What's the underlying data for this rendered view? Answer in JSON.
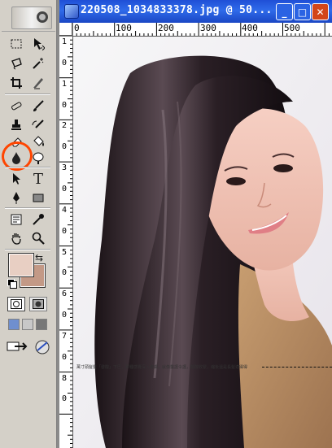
{
  "document": {
    "title": "220508_1034833378.jpg @ 50...",
    "window_buttons": {
      "minimize": "_",
      "maximize": "□",
      "close": "✕"
    }
  },
  "ruler": {
    "h_labels": [
      "0",
      "100",
      "200",
      "300",
      "400",
      "500"
    ],
    "v_labels": [
      "1",
      "0",
      "1",
      "0",
      "2",
      "0",
      "3",
      "0",
      "4",
      "0",
      "5",
      "0",
      "6",
      "0",
      "7",
      "0",
      "8",
      "0"
    ]
  },
  "canvas": {
    "caption": "萬寸頭髮髮「發酸」下巴，那種感覺深入皮膚，就像醫護令護，酸酸收緊，縮後還是長髮適得得"
  },
  "toolbox": {
    "tools": [
      {
        "name": "marquee-tool",
        "icon": "marquee-icon"
      },
      {
        "name": "move-tool",
        "icon": "move-icon"
      },
      {
        "name": "lasso-tool",
        "icon": "lasso-icon"
      },
      {
        "name": "magic-wand-tool",
        "icon": "magic-wand-icon"
      },
      {
        "name": "crop-tool",
        "icon": "crop-icon"
      },
      {
        "name": "slice-tool",
        "icon": "slice-icon"
      },
      {
        "name": "healing-brush-tool",
        "icon": "bandage-icon"
      },
      {
        "name": "brush-tool",
        "icon": "brush-icon"
      },
      {
        "name": "clone-stamp-tool",
        "icon": "stamp-icon"
      },
      {
        "name": "history-brush-tool",
        "icon": "history-brush-icon"
      },
      {
        "name": "eraser-tool",
        "icon": "eraser-icon"
      },
      {
        "name": "paint-bucket-tool",
        "icon": "bucket-icon"
      },
      {
        "name": "blur-tool",
        "icon": "drop-icon"
      },
      {
        "name": "dodge-tool",
        "icon": "dodge-icon"
      },
      {
        "name": "path-selection-tool",
        "icon": "arrow-icon"
      },
      {
        "name": "type-tool",
        "icon": "type-icon",
        "label": "T"
      },
      {
        "name": "pen-tool",
        "icon": "pen-icon"
      },
      {
        "name": "rectangle-tool",
        "icon": "rectangle-icon"
      },
      {
        "name": "notes-tool",
        "icon": "notes-icon"
      },
      {
        "name": "eyedropper-tool",
        "icon": "eyedropper-icon"
      },
      {
        "name": "hand-tool",
        "icon": "hand-icon"
      },
      {
        "name": "zoom-tool",
        "icon": "zoom-icon"
      }
    ],
    "colors": {
      "foreground": "#e8cfc3",
      "background": "#c39986",
      "highlight": "#ff4500"
    }
  }
}
